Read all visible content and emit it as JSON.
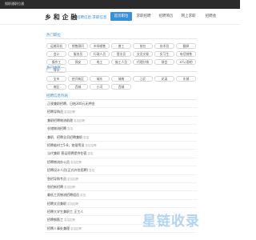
{
  "topbar": {
    "text": "搜职通职位通"
  },
  "header": {
    "logo": "乡 和 企 融",
    "logo_sub": "招聘信息 求职信息",
    "nav": [
      {
        "label": "首页职位",
        "active": true
      },
      {
        "label": "求职招聘",
        "active": false
      },
      {
        "label": "招聘简历",
        "active": false
      },
      {
        "label": "网上求职",
        "active": false
      },
      {
        "label": "招聘会",
        "active": false
      }
    ]
  },
  "categories": {
    "title": "热门职位",
    "tags": [
      "运输司机",
      "销售顾问",
      "市场销售",
      "普工",
      "前台",
      "技术员",
      "翻译",
      "会计",
      "服务员",
      "行政人员",
      "营业员",
      "文员文秘",
      "实习生",
      "电话销售",
      "操作工",
      "保安",
      "电工",
      "施工人员",
      "代理分销",
      "财会",
      "KTV/酒吧",
      "保洁"
    ]
  },
  "regions": {
    "title": "热门地区",
    "tags": [
      "全市",
      "经开新区",
      "城东",
      "城南",
      "江北",
      "花溪",
      "东城",
      "南区",
      "西城",
      "小河",
      "西城"
    ]
  },
  "jobs": {
    "title": "招聘信息列表",
    "items": [
      {
        "text": "正规兼职招聘，日结300元无押金",
        "meta": ""
      },
      {
        "text": "招聘导购员",
        "meta": "急招招聘"
      },
      {
        "text": "兼职招聘物流助理",
        "meta": "急招招聘"
      },
      {
        "text": "仓储物流招聘",
        "meta": "急招"
      },
      {
        "text": "兼职、招聘全员招聘兼职",
        "meta": "急招"
      },
      {
        "text": "招聘临时工5-8，收银等员",
        "meta": "急招招聘"
      },
      {
        "text": "当代兼职 营运招聘提供住宿",
        "meta": "急招"
      },
      {
        "text": "招聘物流办公员",
        "meta": "急招招聘"
      },
      {
        "text": "招聘设计人员(正式外包招聘)",
        "meta": "急招"
      },
      {
        "text": "急招导购专员",
        "meta": "急招招聘"
      },
      {
        "text": "急招新招聘",
        "meta": "急招招聘"
      },
      {
        "text": "最低工资物流招聘组员",
        "meta": "急招"
      },
      {
        "text": "招聘文员兼职",
        "meta": "急招招聘"
      },
      {
        "text": "招聘大学生兼职工 正工人",
        "meta": ""
      },
      {
        "text": "招聘钢筋工",
        "meta": "急招招聘"
      },
      {
        "text": "招聘人事处兼理",
        "meta": "急招招聘"
      }
    ]
  },
  "watermark": "星链收录"
}
